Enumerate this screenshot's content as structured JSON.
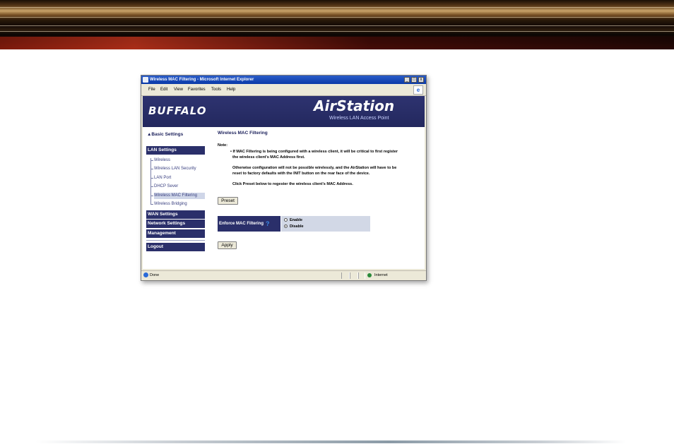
{
  "window": {
    "title": "Wireless MAC Filtering - Microsoft Internet Explorer",
    "buttons": {
      "minimize": "_",
      "maximize": "□",
      "close": "x"
    }
  },
  "menubar": [
    "File",
    "Edit",
    "View",
    "Favorites",
    "Tools",
    "Help"
  ],
  "header": {
    "brand": "BUFFALO",
    "product": "AirStation",
    "product_sub": "Wireless LAN Access Point"
  },
  "sidebar": {
    "basic": "▲Basic Settings",
    "lan_heading": "LAN Settings",
    "lan_items": [
      "Wireless",
      "Wireless LAN Security",
      "LAN Port",
      "DHCP Sever",
      "Wireless MAC Filtering",
      "Wireless Bridging"
    ],
    "active_item": "Wireless MAC Filtering",
    "wan": "WAN Settings",
    "network": "Network Settings",
    "management": "Management",
    "logout": "Logout"
  },
  "main": {
    "title": "Wireless MAC Filtering",
    "note_label": "Note:",
    "note_lines": [
      "• If MAC Filtering is being configured with a wireless client, it will be critical to first register",
      "the wireless client's MAC Address first.",
      "Otherwise configuration will not be possible wirelessly, and the AirStation will have to be",
      "reset to factory defaults with the INIT button on the rear face of the device.",
      "Click Preset below to regester the wireless client's MAC Address."
    ],
    "preset_button": "Preset",
    "option_label": "Enforce MAC Filtering",
    "help_icon": "?",
    "options": [
      "Enable",
      "Disable"
    ],
    "selected_option": "Disable",
    "apply_button": "Apply"
  },
  "statusbar": {
    "left": "Done",
    "zone": "Internet"
  },
  "colors": {
    "nav": "#2a2f6a",
    "header": "#2e3370",
    "accent": "#1a1f5a"
  }
}
